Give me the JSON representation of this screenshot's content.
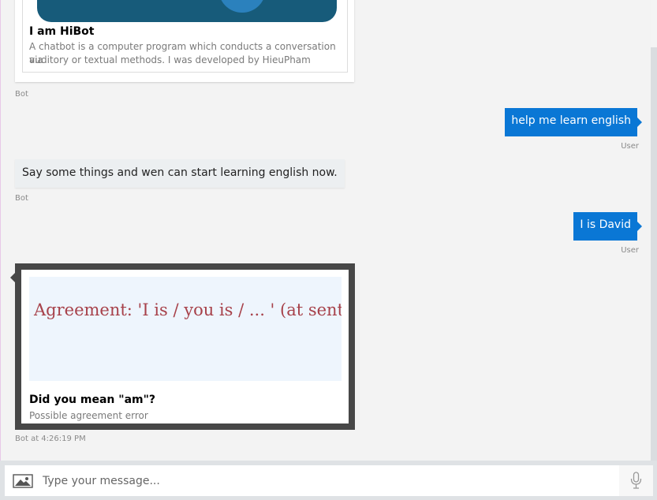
{
  "messages": {
    "hero_card": {
      "title": "I am HiBot",
      "subtitle_line1": "A chatbot is a computer program which conducts a conversation via",
      "subtitle_line2": "auditory or textual methods. I was developed by HieuPham",
      "sender": "Bot"
    },
    "user_msg_1": {
      "text": "help me learn english",
      "sender": "User"
    },
    "bot_msg_1": {
      "text": "Say some things and wen can start learning english now.",
      "sender": "Bot"
    },
    "user_msg_2": {
      "text": "I is David",
      "sender": "User"
    },
    "hint_card": {
      "image_text": "Agreement: 'I is / you is / ... ' (at sent",
      "title": "Did you mean \"am\"?",
      "subtitle": "Possible agreement error",
      "sender_time": "Bot at 4:26:19 PM"
    }
  },
  "composer": {
    "placeholder": "Type your message..."
  },
  "icons": {
    "upload": "image-upload-icon",
    "mic": "microphone-icon"
  },
  "colors": {
    "user_bubble": "#0a77d5",
    "bot_bubble": "#eceff1",
    "card_border": "#474747"
  }
}
